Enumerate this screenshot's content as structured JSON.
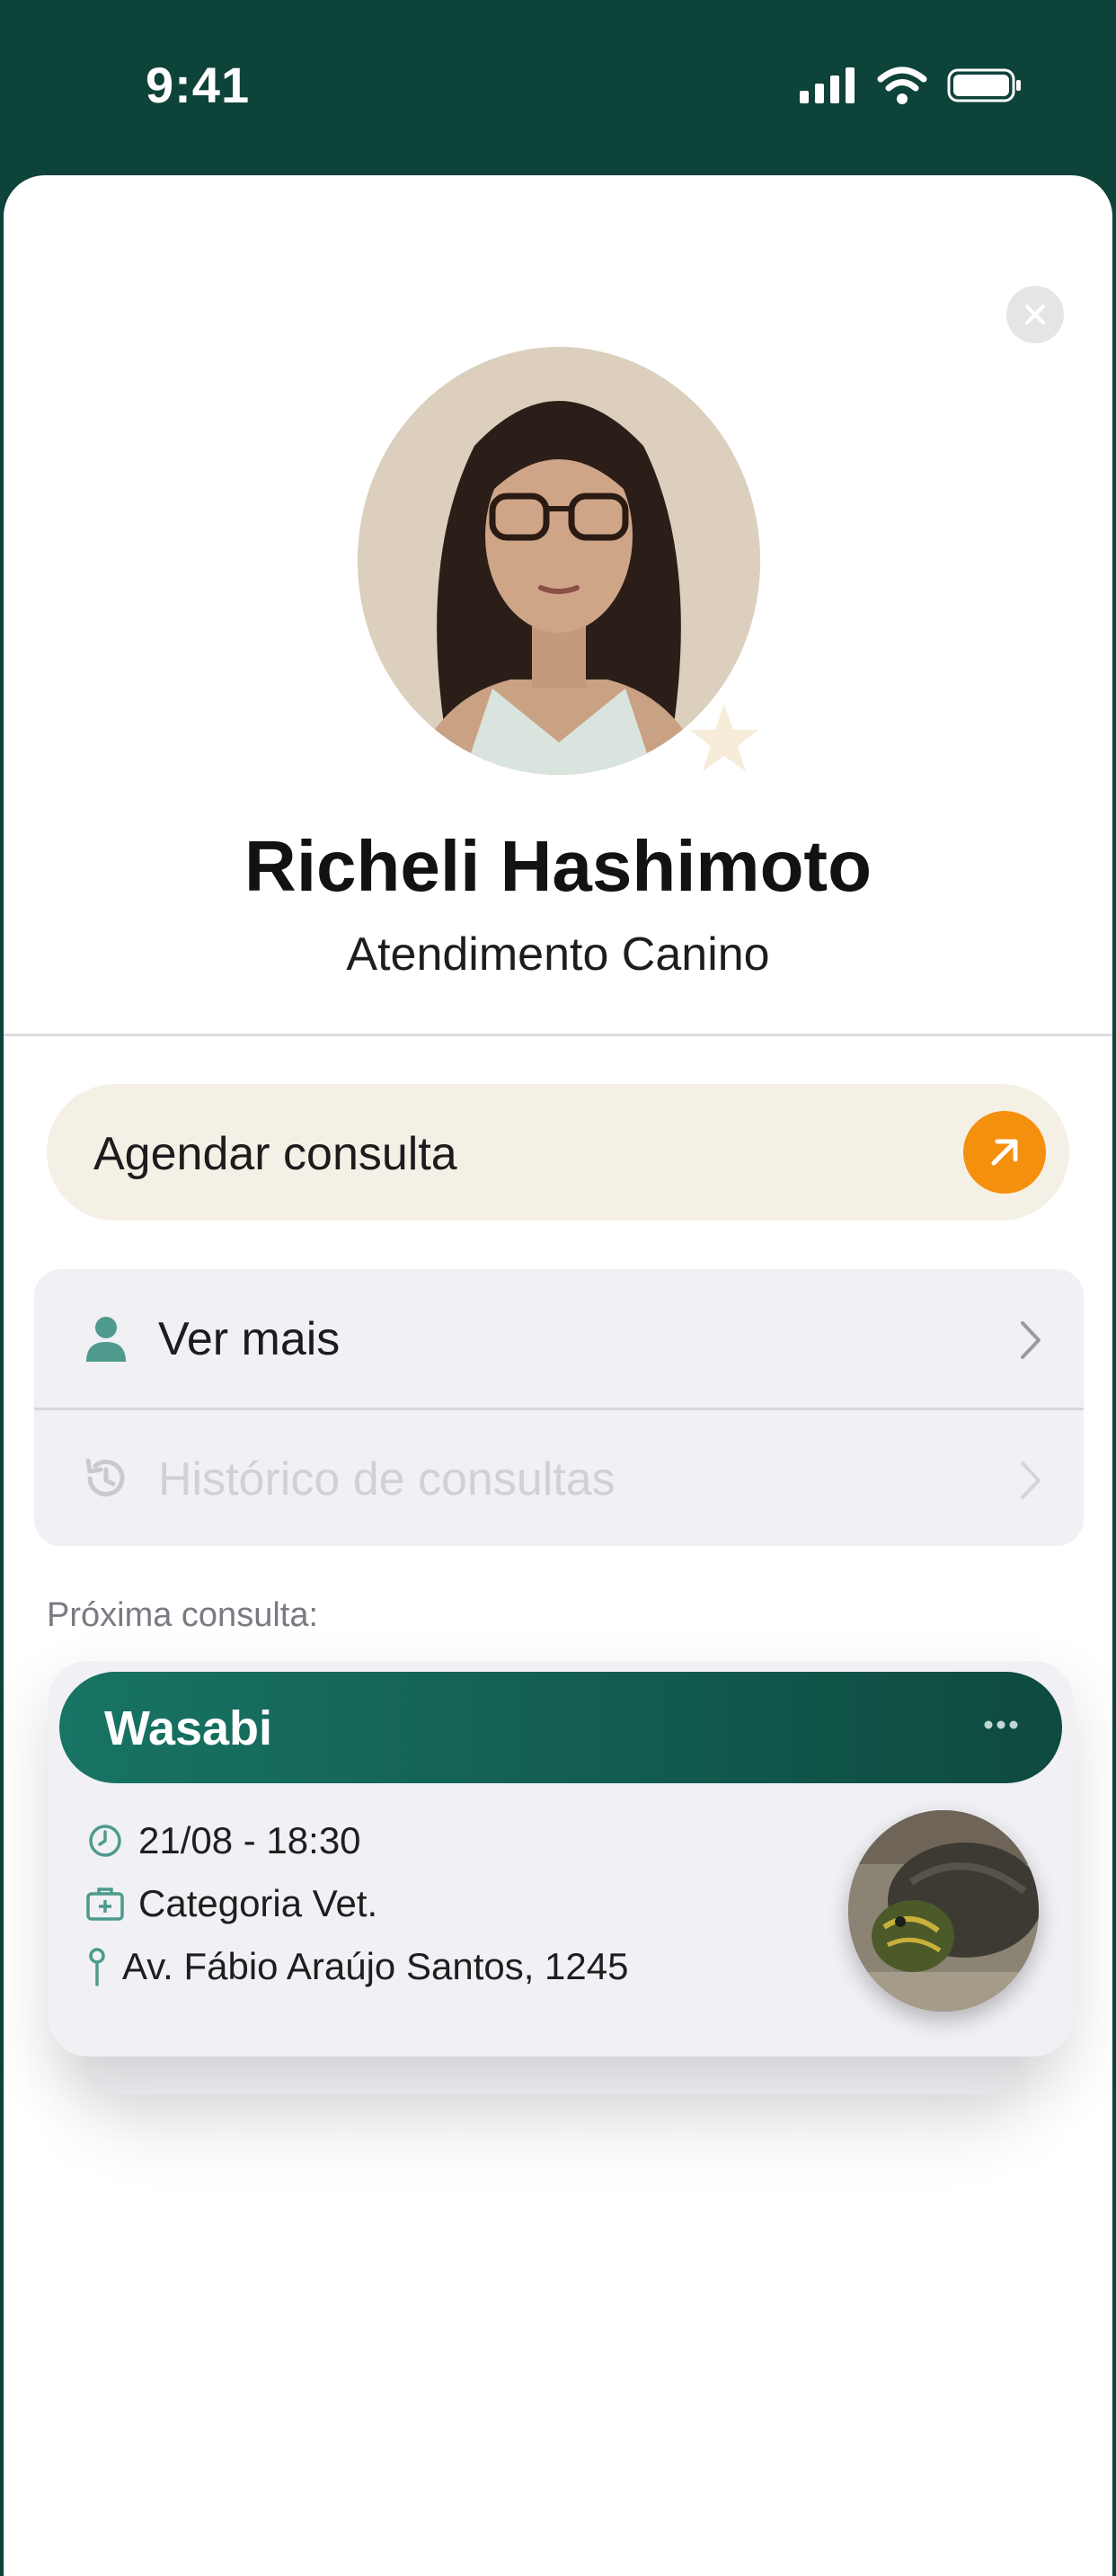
{
  "status_bar": {
    "time": "9:41"
  },
  "profile": {
    "name": "Richeli Hashimoto",
    "role": "Atendimento Canino"
  },
  "actions": {
    "schedule_label": "Agendar consulta"
  },
  "menu": {
    "items": [
      {
        "label": "Ver mais",
        "icon": "person-icon",
        "enabled": true
      },
      {
        "label": "Histórico de consultas",
        "icon": "history-icon",
        "enabled": false
      }
    ]
  },
  "next_appointment": {
    "section_label": "Próxima consulta:",
    "pet_name": "Wasabi",
    "datetime": "21/08 - 18:30",
    "category": "Categoria Vet.",
    "address": "Av. Fábio Araújo Santos, 1245"
  },
  "colors": {
    "header_bg": "#0e433a",
    "accent_orange": "#f5900e",
    "schedule_bg": "#f4f0e6",
    "card_bg": "#f0f0f5",
    "teal_icon": "#4e9a8c"
  }
}
